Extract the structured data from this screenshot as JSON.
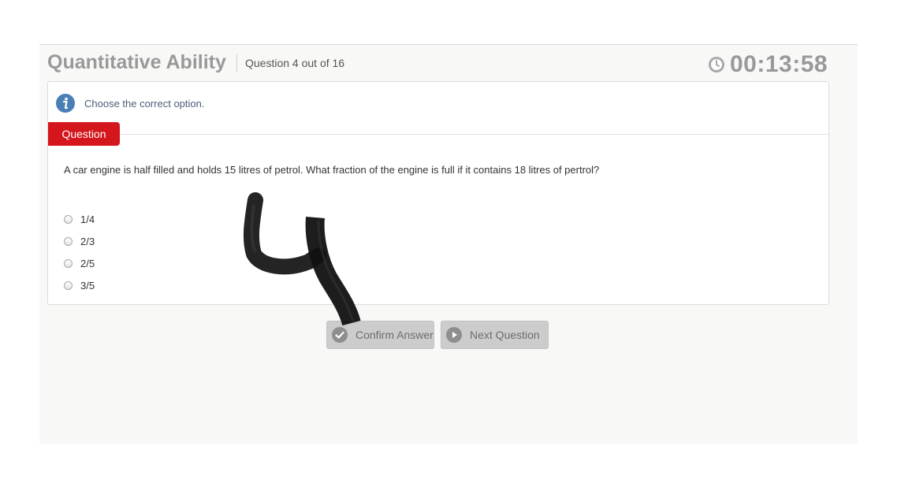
{
  "header": {
    "title": "Quantitative Ability",
    "question_count": "Question 4 out of 16",
    "timer": "00:13:58"
  },
  "info": {
    "text": "Choose the correct option."
  },
  "question": {
    "tab_label": "Question",
    "text": "A car engine is half filled and holds 15 litres of petrol. What fraction of the engine is full if it contains 18 litres of pertrol?",
    "options": [
      {
        "label": "1/4",
        "selected": false
      },
      {
        "label": "2/3",
        "selected": false
      },
      {
        "label": "2/5",
        "selected": false
      },
      {
        "label": "3/5",
        "selected": false
      }
    ]
  },
  "buttons": {
    "confirm_label": "Confirm Answer",
    "next_label": "Next Question"
  },
  "icons": {
    "timer": "clock-icon",
    "info": "info-icon",
    "confirm": "check-circle-icon",
    "next": "play-circle-icon"
  },
  "colors": {
    "question_tab": "#d5161c",
    "header_text": "#999999",
    "info_icon": "#4a7fb5",
    "button_bg": "#cccccc"
  }
}
